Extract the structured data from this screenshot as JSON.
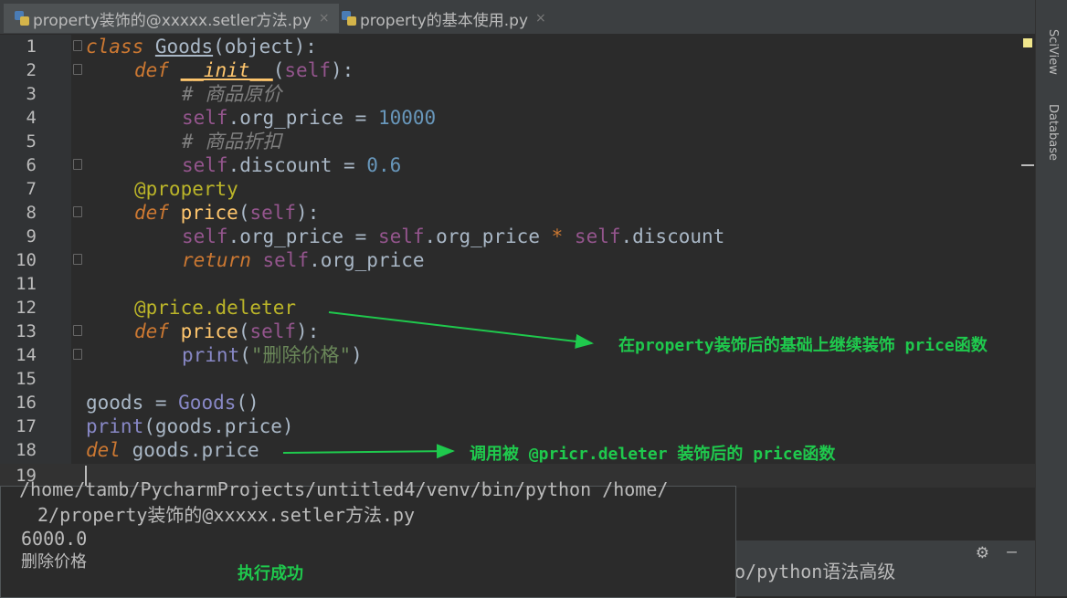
{
  "tabs": [
    {
      "label": "property装饰的@xxxxx.setler方法.py",
      "close": "×"
    },
    {
      "label": "property的基本使用.py",
      "close": "×"
    }
  ],
  "sidebar": {
    "sciview": "SciView",
    "database": "Database"
  },
  "editor": {
    "lines": [
      {
        "n": "1"
      },
      {
        "n": "2"
      },
      {
        "n": "3"
      },
      {
        "n": "4"
      },
      {
        "n": "5"
      },
      {
        "n": "6"
      },
      {
        "n": "7"
      },
      {
        "n": "8"
      },
      {
        "n": "9"
      },
      {
        "n": "10"
      },
      {
        "n": "11"
      },
      {
        "n": "12"
      },
      {
        "n": "13"
      },
      {
        "n": "14"
      },
      {
        "n": "15"
      },
      {
        "n": "16"
      },
      {
        "n": "17"
      },
      {
        "n": "18"
      },
      {
        "n": "19"
      }
    ],
    "tokens": {
      "l1": [
        "class",
        " ",
        "Goods",
        "(object):"
      ],
      "l2": [
        "def",
        " ",
        "__init__",
        "(",
        "self",
        "):"
      ],
      "l3": [
        "# 商品原价"
      ],
      "l4": [
        "self",
        ".org_price = ",
        "10000"
      ],
      "l5": [
        "# 商品折扣"
      ],
      "l6": [
        "self",
        ".discount = ",
        "0.6"
      ],
      "l7": [
        "@property"
      ],
      "l8": [
        "def",
        " ",
        "price",
        "(",
        "self",
        "):"
      ],
      "l9": [
        "self",
        ".org_price = ",
        "self",
        ".org_price ",
        "*",
        " ",
        "self",
        ".discount"
      ],
      "l10": [
        "return",
        " ",
        "self",
        ".org_price"
      ],
      "l12": [
        "@price.deleter"
      ],
      "l13": [
        "def",
        " ",
        "price",
        "(",
        "self",
        "):"
      ],
      "l14": [
        "print",
        "(",
        "\"删除价格\"",
        ")"
      ],
      "l16": [
        "goods = ",
        "Goods",
        "()"
      ],
      "l17": [
        "print",
        "(goods.price)"
      ],
      "l18": [
        "del",
        " goods.price"
      ]
    }
  },
  "annotations": {
    "a1": "在property装饰后的基础上继续装饰 price函数",
    "a2": "调用被 @pricr.deleter 装饰后的 price函数",
    "a3": "执行成功"
  },
  "run": {
    "path1": "/home/tamb/PycharmProjects/untitled4/venv/bin/python /home/",
    "path2": "2/property装饰的@xxxxx.setler方法.py",
    "out1": "6000.0",
    "out2": "删除价格",
    "bg_text": "o/python语法高级"
  },
  "colors": {
    "annotation": "#1fc94d",
    "keyword": "#cc7832",
    "self": "#94558d",
    "number": "#6897bb",
    "decorator": "#bbb529"
  }
}
